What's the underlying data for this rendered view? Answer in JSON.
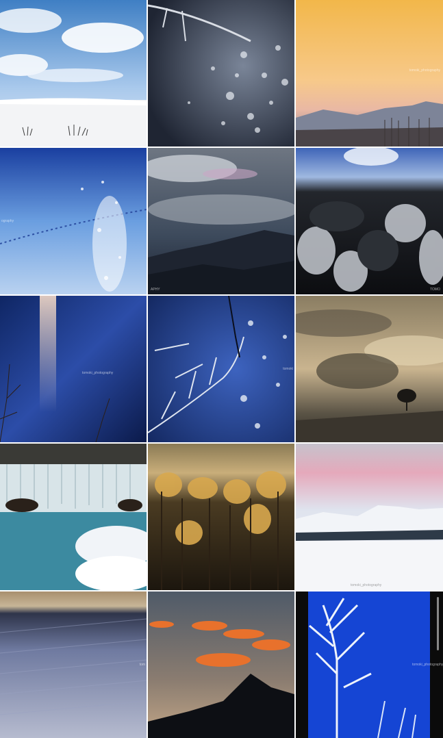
{
  "grid": {
    "photos": [
      {
        "subject": "snow-dune-under-clouds"
      },
      {
        "subject": "frosted-branch-sparkles"
      },
      {
        "subject": "sunset-mountain-ridge",
        "watermark": "tomoki_photography"
      },
      {
        "subject": "snow-field-with-tracks",
        "watermark": "ography"
      },
      {
        "subject": "rainbow-cloud-mountains",
        "watermark": "APHY"
      },
      {
        "subject": "frosty-forest-at-night",
        "watermark": "TOMO"
      },
      {
        "subject": "light-pillar-on-snow",
        "watermark": "tomoki_photography"
      },
      {
        "subject": "iced-branches-blue",
        "watermark": "tomoki"
      },
      {
        "subject": "lone-tree-sunrays"
      },
      {
        "subject": "waterfall-snow-rocks"
      },
      {
        "subject": "golden-frosted-forest"
      },
      {
        "subject": "pink-sky-snow-mountain",
        "watermark": "tomoki_photography"
      },
      {
        "subject": "snow-slope-sunset",
        "watermark": "tom"
      },
      {
        "subject": "orange-clouds-peak"
      },
      {
        "subject": "rime-ice-tree-blue-sky",
        "watermark": "tomoki_photography"
      }
    ]
  }
}
